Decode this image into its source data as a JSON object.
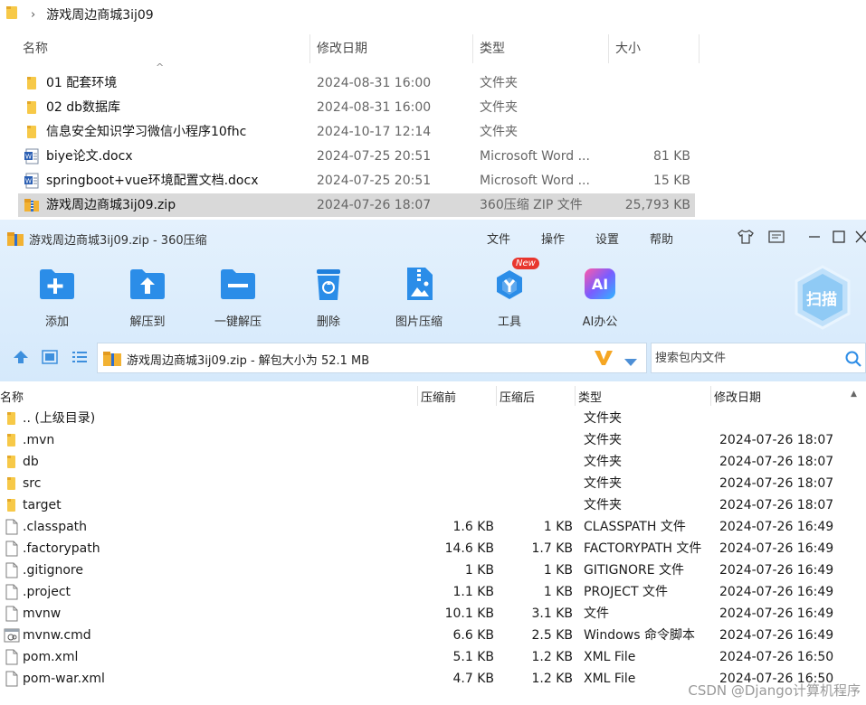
{
  "explorer": {
    "breadcrumb": "游戏周边商城3ij09",
    "columns": {
      "name": "名称",
      "date": "修改日期",
      "type": "类型",
      "size": "大小"
    },
    "files": [
      {
        "icon": "folder",
        "name": "01 配套环境",
        "date": "2024-08-31 16:00",
        "type": "文件夹",
        "size": ""
      },
      {
        "icon": "folder",
        "name": "02 db数据库",
        "date": "2024-08-31 16:00",
        "type": "文件夹",
        "size": ""
      },
      {
        "icon": "folder",
        "name": "信息安全知识学习微信小程序10fhc",
        "date": "2024-10-17 12:14",
        "type": "文件夹",
        "size": ""
      },
      {
        "icon": "word",
        "name": "biye论文.docx",
        "date": "2024-07-25 20:51",
        "type": "Microsoft Word ...",
        "size": "81 KB"
      },
      {
        "icon": "word",
        "name": "springboot+vue环境配置文档.docx",
        "date": "2024-07-25 20:51",
        "type": "Microsoft Word ...",
        "size": "15 KB"
      },
      {
        "icon": "zip",
        "name": "游戏周边商城3ij09.zip",
        "date": "2024-07-26 18:07",
        "type": "360压缩 ZIP 文件",
        "size": "25,793 KB"
      }
    ]
  },
  "zip_window": {
    "title": "游戏周边商城3ij09.zip - 360压缩",
    "menu": [
      "文件",
      "操作",
      "设置",
      "帮助"
    ],
    "toolbar": [
      {
        "label": "添加",
        "icon": "add-folder-icon"
      },
      {
        "label": "解压到",
        "icon": "extract-to-icon"
      },
      {
        "label": "一键解压",
        "icon": "one-click-extract-icon"
      },
      {
        "label": "删除",
        "icon": "delete-icon"
      },
      {
        "label": "图片压缩",
        "icon": "image-compress-icon"
      },
      {
        "label": "工具",
        "icon": "tools-icon",
        "badge": "New"
      },
      {
        "label": "AI办公",
        "icon": "ai-office-icon",
        "icon_text": "AI"
      }
    ],
    "scan_label": "扫描",
    "address": "游戏周边商城3ij09.zip - 解包大小为 52.1 MB",
    "search_placeholder": "搜索包内文件",
    "columns": {
      "name": "名称",
      "packed": "压缩前",
      "compressed": "压缩后",
      "type": "类型",
      "date": "修改日期"
    },
    "entries": [
      {
        "icon": "folder",
        "name": ".. (上级目录)",
        "packed": "",
        "compressed": "",
        "type": "文件夹",
        "date": ""
      },
      {
        "icon": "folder",
        "name": ".mvn",
        "packed": "",
        "compressed": "",
        "type": "文件夹",
        "date": "2024-07-26 18:07"
      },
      {
        "icon": "folder",
        "name": "db",
        "packed": "",
        "compressed": "",
        "type": "文件夹",
        "date": "2024-07-26 18:07"
      },
      {
        "icon": "folder",
        "name": "src",
        "packed": "",
        "compressed": "",
        "type": "文件夹",
        "date": "2024-07-26 18:07"
      },
      {
        "icon": "folder",
        "name": "target",
        "packed": "",
        "compressed": "",
        "type": "文件夹",
        "date": "2024-07-26 18:07"
      },
      {
        "icon": "file",
        "name": ".classpath",
        "packed": "1.6 KB",
        "compressed": "1 KB",
        "type": "CLASSPATH 文件",
        "date": "2024-07-26 16:49"
      },
      {
        "icon": "file",
        "name": ".factorypath",
        "packed": "14.6 KB",
        "compressed": "1.7 KB",
        "type": "FACTORYPATH 文件",
        "date": "2024-07-26 16:49"
      },
      {
        "icon": "file",
        "name": ".gitignore",
        "packed": "1 KB",
        "compressed": "1 KB",
        "type": "GITIGNORE 文件",
        "date": "2024-07-26 16:49"
      },
      {
        "icon": "file",
        "name": ".project",
        "packed": "1.1 KB",
        "compressed": "1 KB",
        "type": "PROJECT 文件",
        "date": "2024-07-26 16:49"
      },
      {
        "icon": "file",
        "name": "mvnw",
        "packed": "10.1 KB",
        "compressed": "3.1 KB",
        "type": "文件",
        "date": "2024-07-26 16:49"
      },
      {
        "icon": "cmd",
        "name": "mvnw.cmd",
        "packed": "6.6 KB",
        "compressed": "2.5 KB",
        "type": "Windows 命令脚本",
        "date": "2024-07-26 16:49"
      },
      {
        "icon": "file",
        "name": "pom.xml",
        "packed": "5.1 KB",
        "compressed": "1.2 KB",
        "type": "XML File",
        "date": "2024-07-26 16:50"
      },
      {
        "icon": "file",
        "name": "pom-war.xml",
        "packed": "4.7 KB",
        "compressed": "1.2 KB",
        "type": "XML File",
        "date": "2024-07-26 16:50"
      }
    ]
  },
  "watermark": "CSDN @Django计算机程序",
  "colors": {
    "folder": "#f7c948",
    "accent": "#2e8de6",
    "zip_band": "#d5e9fb",
    "selection": "#d9d9d9"
  }
}
